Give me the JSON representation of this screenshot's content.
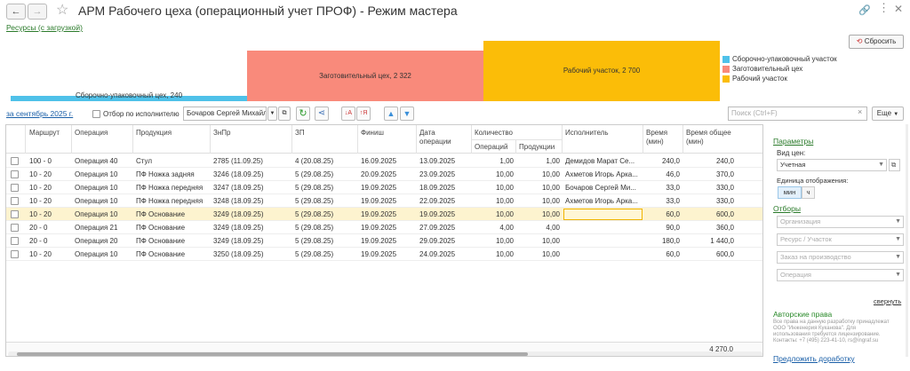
{
  "window": {
    "title": "АРМ Рабочего цеха (операционный учет ПРОФ) - Режим мастера"
  },
  "resources_link": "Ресурсы (с загрузкой)",
  "reset_button": "Сбросить",
  "gantt": {
    "bars": [
      {
        "label": "Сборочно-упаковочный цех, 240",
        "value": 240,
        "color": "#4fc1e9"
      },
      {
        "label": "Заготовительный цех, 2 322",
        "value": 2322,
        "color": "#f98a7b"
      },
      {
        "label": "Рабочий участок, 2 700",
        "value": 2700,
        "color": "#fbbd08"
      }
    ],
    "legend": [
      {
        "label": "Сборочно-упаковочный участок",
        "color": "#4fc1e9"
      },
      {
        "label": "Заготовительный цех",
        "color": "#f98a7b"
      },
      {
        "label": "Рабочий участок",
        "color": "#fbbd08"
      }
    ]
  },
  "toolbar": {
    "period_link": "за сентябрь 2025 г.",
    "filter_checkbox_label": "Отбор по исполнителю",
    "executor_value": "Бочаров Сергей Михайл",
    "search_placeholder": "Поиск (Ctrl+F)",
    "more_button": "Еще"
  },
  "table": {
    "headers": {
      "route": "Маршрут",
      "operation": "Операция",
      "product": "Продукция",
      "znpr": "ЗнПр",
      "zp": "ЗП",
      "finish": "Финиш",
      "date_line1": "Дата",
      "date_line2": "операции",
      "qty": "Количество",
      "qty_ops": "Операций",
      "qty_prod": "Продукции",
      "executor": "Исполнитель",
      "time_line1": "Время",
      "time_line2": "(мин)",
      "total_line1": "Время общее",
      "total_line2": "(мин)"
    },
    "rows": [
      {
        "route": "100 - 0",
        "operation": "Операция 40",
        "product": "Стул",
        "znpr": "2785 (11.09.25)",
        "zp": "4 (20.08.25)",
        "finish": "16.09.2025",
        "date": "13.09.2025",
        "ops": "1,00",
        "prod": "1,00",
        "executor": "Демидов Марат Се...",
        "time": "240,0",
        "total": "240,0"
      },
      {
        "route": "10 - 20",
        "operation": "Операция 10",
        "product": "ПФ Ножка задняя",
        "znpr": "3246 (18.09.25)",
        "zp": "5 (29.08.25)",
        "finish": "20.09.2025",
        "date": "23.09.2025",
        "ops": "10,00",
        "prod": "10,00",
        "executor": "Ахметов Игорь Арка...",
        "time": "46,0",
        "total": "370,0"
      },
      {
        "route": "10 - 20",
        "operation": "Операция 10",
        "product": "ПФ Ножка передняя",
        "znpr": "3247 (18.09.25)",
        "zp": "5 (29.08.25)",
        "finish": "19.09.2025",
        "date": "18.09.2025",
        "ops": "10,00",
        "prod": "10,00",
        "executor": "Бочаров Сергей Ми...",
        "time": "33,0",
        "total": "330,0"
      },
      {
        "route": "10 - 20",
        "operation": "Операция 10",
        "product": "ПФ Ножка передняя",
        "znpr": "3248 (18.09.25)",
        "zp": "5 (29.08.25)",
        "finish": "19.09.2025",
        "date": "22.09.2025",
        "ops": "10,00",
        "prod": "10,00",
        "executor": "Ахметов Игорь Арка...",
        "time": "33,0",
        "total": "330,0"
      },
      {
        "route": "10 - 20",
        "operation": "Операция 10",
        "product": "ПФ Основание",
        "znpr": "3249 (18.09.25)",
        "zp": "5 (29.08.25)",
        "finish": "19.09.2025",
        "date": "19.09.2025",
        "ops": "10,00",
        "prod": "10,00",
        "executor": "",
        "time": "60,0",
        "total": "600,0"
      },
      {
        "route": "20 - 0",
        "operation": "Операция 21",
        "product": "ПФ Основание",
        "znpr": "3249 (18.09.25)",
        "zp": "5 (29.08.25)",
        "finish": "19.09.2025",
        "date": "27.09.2025",
        "ops": "4,00",
        "prod": "4,00",
        "executor": "",
        "time": "90,0",
        "total": "360,0"
      },
      {
        "route": "20 - 0",
        "operation": "Операция 20",
        "product": "ПФ Основание",
        "znpr": "3249 (18.09.25)",
        "zp": "5 (29.08.25)",
        "finish": "19.09.2025",
        "date": "29.09.2025",
        "ops": "10,00",
        "prod": "10,00",
        "executor": "",
        "time": "180,0",
        "total": "1 440,0"
      },
      {
        "route": "10 - 20",
        "operation": "Операция 10",
        "product": "ПФ Основание",
        "znpr": "3250 (18.09.25)",
        "zp": "5 (29.08.25)",
        "finish": "19.09.2025",
        "date": "24.09.2025",
        "ops": "10,00",
        "prod": "10,00",
        "executor": "",
        "time": "60,0",
        "total": "600,0"
      }
    ],
    "footer_total": "4 270,0"
  },
  "panel": {
    "params_title": "Параметры",
    "price_type_label": "Вид цен:",
    "price_type_value": "Учетная",
    "unit_label": "Единица отображения:",
    "unit_min": "мин",
    "unit_h": "ч",
    "filters_title": "Отборы",
    "filter_org": "Организация",
    "filter_resource": "Ресурс / Участок",
    "filter_order": "Заказ на производство",
    "filter_operation": "Операция",
    "collapse_link": "свернуть",
    "copyright_title": "Авторские права",
    "copyright_text_1": "Все права на данную разработку принадлежат",
    "copyright_text_2": "ООО \"Инженерия Куканова\". Для",
    "copyright_text_3": "использования требуется лицензирование.",
    "copyright_text_4": "Контакты: +7 (495) 223-41-10, rs@ingraf.su",
    "suggest_link": "Предложить доработку"
  }
}
